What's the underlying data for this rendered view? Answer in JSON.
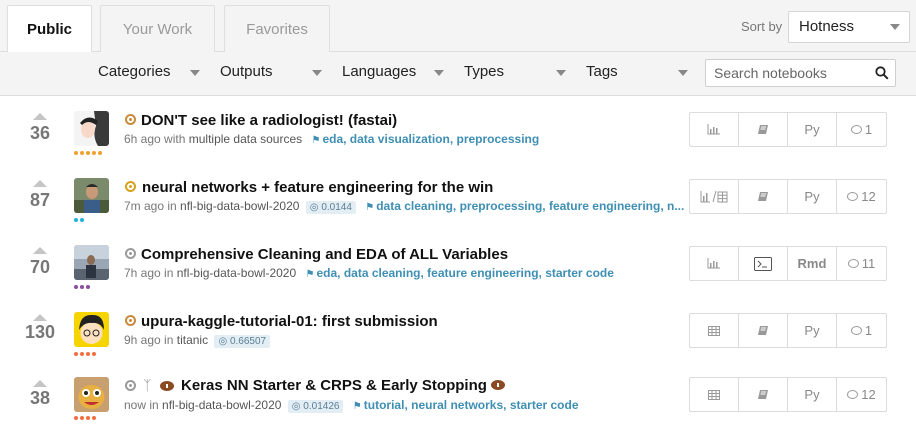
{
  "tabs": [
    {
      "label": "Public",
      "active": true
    },
    {
      "label": "Your Work",
      "active": false
    },
    {
      "label": "Favorites",
      "active": false
    }
  ],
  "sort": {
    "label": "Sort by",
    "value": "Hotness"
  },
  "filters": [
    "Categories",
    "Outputs",
    "Languages",
    "Types",
    "Tags"
  ],
  "search": {
    "placeholder": "Search notebooks"
  },
  "notebooks": [
    {
      "votes": "36",
      "title": "DON'T see like a radiologist! (fastai)",
      "time": "6h ago with",
      "source": "multiple data sources",
      "score": "",
      "tags": [
        "eda",
        "data visualization",
        "preprocessing"
      ],
      "actions": [
        "chart-icon",
        "notebook-icon",
        "Py",
        "1"
      ],
      "medal_color": "#c98a3c",
      "dots": [
        "#f0a030",
        "#f0a030",
        "#f0a030",
        "#f0a030",
        "#f0a030"
      ]
    },
    {
      "votes": "87",
      "title": "neural networks + feature engineering for the win",
      "time": "7m ago in",
      "source": "nfl-big-data-bowl-2020",
      "score": "0.0144",
      "tags": [
        "data cleaning",
        "preprocessing",
        "feature engineering",
        "n..."
      ],
      "actions": [
        "chart-table-icon",
        "notebook-icon",
        "Py",
        "12"
      ],
      "medal_color": "#d4a21d",
      "dots": [
        "#20b2d8",
        "#20b2d8"
      ]
    },
    {
      "votes": "70",
      "title": "Comprehensive Cleaning and EDA of ALL Variables",
      "time": "7h ago in",
      "source": "nfl-big-data-bowl-2020",
      "score": "",
      "tags": [
        "eda",
        "data cleaning",
        "feature engineering",
        "starter code"
      ],
      "actions": [
        "chart-icon",
        "console-icon",
        "Rmd",
        "11"
      ],
      "medal_color": "#9a9a9a",
      "dots": [
        "#8b4d9e",
        "#8b4d9e",
        "#8b4d9e"
      ]
    },
    {
      "votes": "130",
      "title": "upura-kaggle-tutorial-01: first submission",
      "time": "9h ago in",
      "source": "titanic",
      "score": "0.66507",
      "tags": [],
      "actions": [
        "table-icon",
        "notebook-icon",
        "Py",
        "1"
      ],
      "medal_color": "#c98a3c",
      "dots": [
        "#f07040",
        "#f07040",
        "#f07040",
        "#f07040"
      ]
    },
    {
      "votes": "38",
      "title": "Keras NN Starter & CRPS & Early Stopping",
      "time": "now in",
      "source": "nfl-big-data-bowl-2020",
      "score": "0.01426",
      "tags": [
        "tutorial",
        "neural networks",
        "starter code"
      ],
      "actions": [
        "table-icon",
        "notebook-icon",
        "Py",
        "12"
      ],
      "medal_color": "#9a9a9a",
      "dots": [
        "#f07040",
        "#f07040",
        "#f07040",
        "#f07040"
      ]
    }
  ]
}
